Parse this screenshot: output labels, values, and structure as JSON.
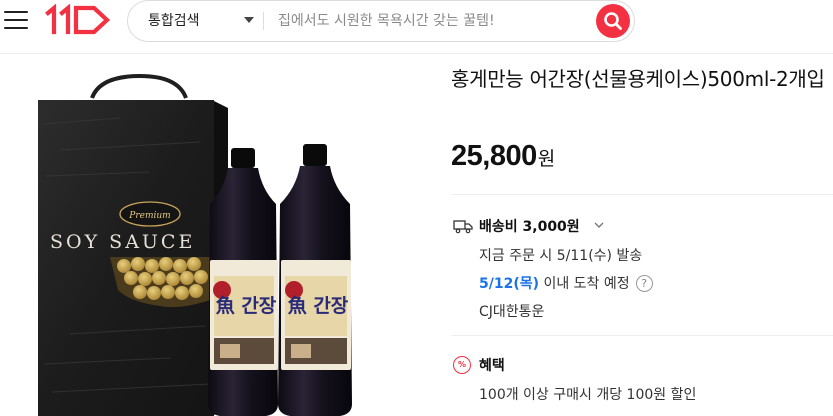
{
  "header": {
    "search": {
      "category": "통합검색",
      "placeholder": "집에서도 시원한 목욕시간 갖는 꿀템!"
    }
  },
  "product": {
    "title": "홍게만능 어간장(선물용케이스)500ml-2개입",
    "price": "25,800",
    "price_unit": "원",
    "image_labels": {
      "box_text": "SOY SAUCE",
      "badge_text": "Premium",
      "bottle_label": "魚 간장"
    }
  },
  "shipping": {
    "title": "배송비 3,000원",
    "dispatch": "지금 주문 시 5/11(수) 발송",
    "arrival_date": "5/12(목)",
    "arrival_suffix": "이내 도착 예정",
    "carrier": "CJ대한통운"
  },
  "benefit": {
    "title": "혜택",
    "line1": "100개 이상 구매시 개당 100원 할인"
  },
  "colors": {
    "brand_red": "#f43142",
    "date_blue": "#1a73e8"
  },
  "icons": [
    "menu-icon",
    "brand-logo",
    "search-icon",
    "truck-icon",
    "chevron-down-icon",
    "help-icon",
    "discount-icon"
  ]
}
